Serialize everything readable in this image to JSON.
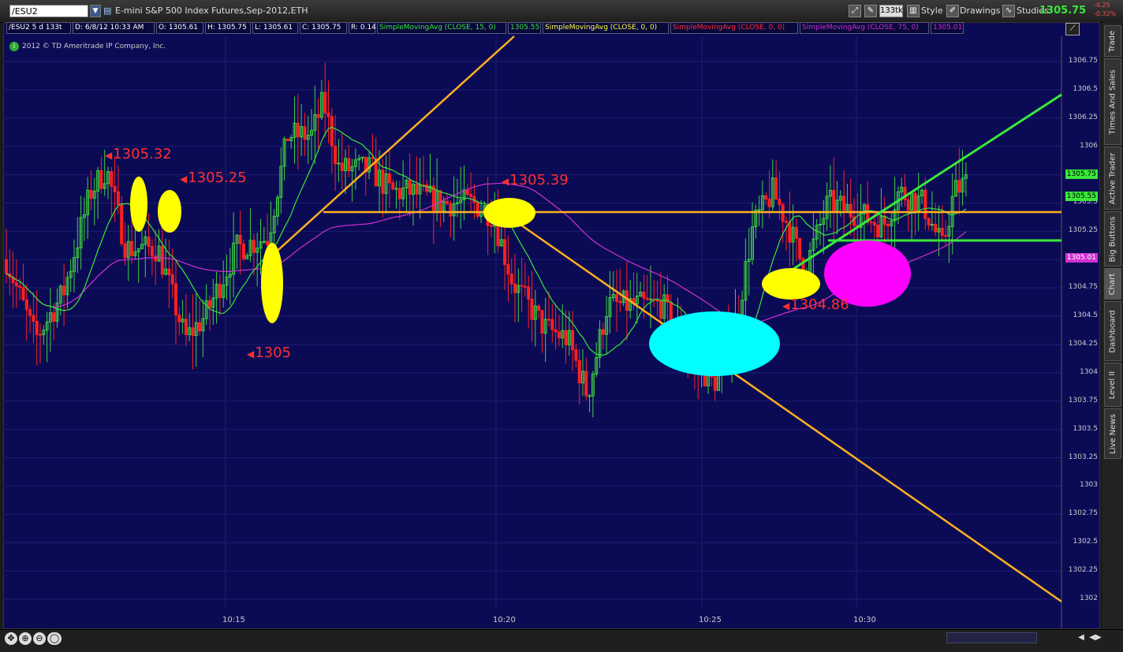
{
  "toolbar": {
    "symbol": "/ESU2",
    "description": "E-mini S&P 500 Index Futures,Sep-2012,ETH",
    "tick_label": "133tk",
    "style_label": "Style",
    "drawings_label": "Drawings",
    "studies_label": "Studies",
    "last_price": "1305.75",
    "change": "-4.25",
    "change_pct": "-0.32%"
  },
  "study_bar": {
    "symbol_period": "/ESU2 5 d 133t",
    "date": "D: 6/8/12 10:33 AM",
    "open": "O: 1305.61",
    "high": "H: 1305.75",
    "low": "L: 1305.61",
    "close": "C: 1305.75",
    "range": "R: 0.14",
    "sma1_label": "SimpleMovingAvg (CLOSE, 15, 0)",
    "sma1_value": "1305.55",
    "sma2_label": "SimpleMovingAvg (CLOSE, 0, 0)",
    "sma3_label": "SimpleMovingAvg (CLOSE, 0, 0)",
    "sma4_label": "SimpleMovingAvg (CLOSE, 75, 0)",
    "sma4_value": "1305.01"
  },
  "copyright": "2012 © TD Ameritrade IP Company, Inc.",
  "price_axis": [
    "1306.75",
    "1306.5",
    "1306.25",
    "1306",
    "1305.75",
    "1305.5",
    "1305.25",
    "1305",
    "1304.75",
    "1304.5",
    "1304.25",
    "1304",
    "1303.75",
    "1303.5",
    "1303.25",
    "1303",
    "1302.75",
    "1302.5",
    "1302.25",
    "1302"
  ],
  "price_tags": {
    "last": "1305.75",
    "sma15": "1305.55",
    "sma75": "1305.01"
  },
  "time_axis": [
    "10:15",
    "10:20",
    "10:25",
    "10:30"
  ],
  "annotations": [
    "1305.32",
    "1305.25",
    "1305.39",
    "1305",
    "1304.86"
  ],
  "right_tabs": [
    "Trade",
    "Times And Sales",
    "Active Trader",
    "Big Buttons",
    "Chart",
    "Dashboard",
    "Level II",
    "Live News"
  ],
  "colors": {
    "background": "#0b0b55",
    "up_candle": "#3fd13f",
    "down_candle": "#ff2020",
    "sma15": "#39e839",
    "sma75": "#d130d1",
    "trend_orange": "#ffb020",
    "ellipse_yellow": "#ffff00",
    "ellipse_cyan": "#00ffff",
    "ellipse_magenta": "#ff00ff",
    "annotation_red": "#ff3030"
  },
  "chart_data": {
    "type": "candlestick",
    "ylim": [
      1302,
      1306.75
    ],
    "x_ticks": [
      "10:15",
      "10:20",
      "10:25",
      "10:30"
    ]
  }
}
